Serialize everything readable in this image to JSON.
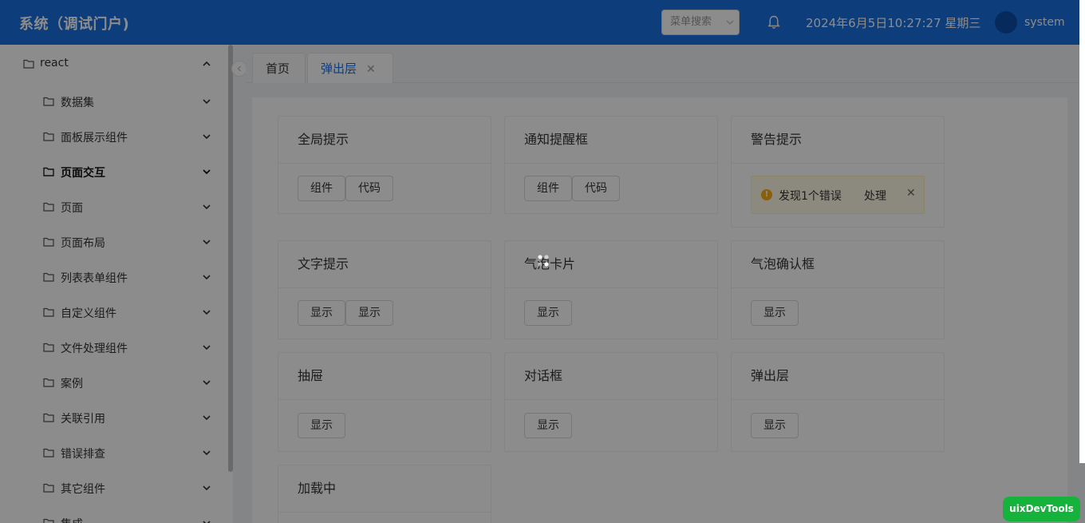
{
  "header": {
    "title": "系统（调试门户)",
    "menu_search_placeholder": "菜单搜索",
    "datetime": "2024年6月5日10:27:27 星期三",
    "username": "system",
    "icons": [
      "bell-icon",
      "chevron-down-icon"
    ]
  },
  "sidebar": {
    "root": {
      "label": "react",
      "icon": "folder-icon",
      "expanded": true
    },
    "items": [
      {
        "label": "数据集"
      },
      {
        "label": "面板展示组件"
      },
      {
        "label": "页面交互",
        "active": true
      },
      {
        "label": "页面"
      },
      {
        "label": "页面布局"
      },
      {
        "label": "列表表单组件"
      },
      {
        "label": "自定义组件"
      },
      {
        "label": "文件处理组件"
      },
      {
        "label": "案例"
      },
      {
        "label": "关联引用"
      },
      {
        "label": "错误排查"
      },
      {
        "label": "其它组件"
      },
      {
        "label": "集成"
      }
    ]
  },
  "tabs": [
    {
      "label": "首页",
      "active": false
    },
    {
      "label": "弹出层",
      "active": true,
      "closable": true,
      "close_symbol": "✕"
    }
  ],
  "cards": {
    "global_tip": {
      "title": "全局提示",
      "buttons": [
        "组件",
        "代码"
      ]
    },
    "notification": {
      "title": "通知提醒框",
      "buttons": [
        "组件",
        "代码"
      ]
    },
    "warning": {
      "title": "警告提示",
      "alert": {
        "icon_text": "!",
        "message": "发现1个错误",
        "action": "处理",
        "close": "✕"
      }
    },
    "tooltip": {
      "title": "文字提示",
      "buttons": [
        "显示",
        "显示"
      ]
    },
    "bubble_card": {
      "title": "气泡卡片",
      "buttons": [
        "显示"
      ]
    },
    "bubble_confirm": {
      "title": "气泡确认框",
      "buttons": [
        "显示"
      ]
    },
    "drawer": {
      "title": "抽屉",
      "buttons": [
        "显示"
      ]
    },
    "dialog": {
      "title": "对话框",
      "buttons": [
        "显示"
      ]
    },
    "popup": {
      "title": "弹出层",
      "buttons": [
        "显示"
      ]
    },
    "loading": {
      "title": "加载中"
    }
  },
  "devtools": {
    "label": "uixDevTools"
  },
  "colors": {
    "header_bg": "#1a6fe0",
    "accent": "#1a6fe0",
    "warning": "#faad14",
    "mask": "rgba(0,0,0,0.45)",
    "devtools_bg": "#15b33b"
  }
}
